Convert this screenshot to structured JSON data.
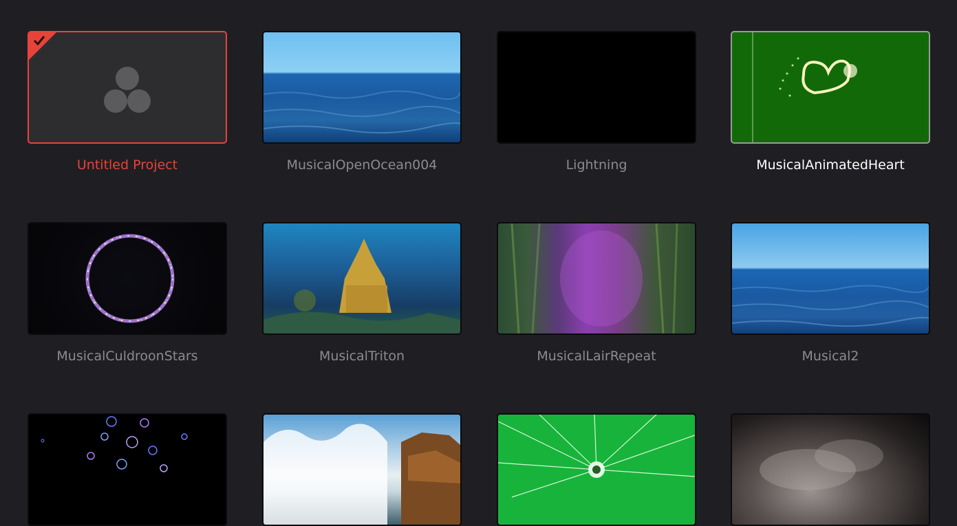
{
  "projects": [
    {
      "name": "Untitled Project",
      "state": "selected",
      "thumbnail": "resolve-logo-icon"
    },
    {
      "name": "MusicalOpenOcean004",
      "state": "normal",
      "thumbnail": "ocean"
    },
    {
      "name": "Lightning",
      "state": "normal",
      "thumbnail": "black"
    },
    {
      "name": "MusicalAnimatedHeart",
      "state": "hovered",
      "thumbnail": "green-heart"
    },
    {
      "name": "MusicalCuldroonStars",
      "state": "normal",
      "thumbnail": "star-ring"
    },
    {
      "name": "MusicalTriton",
      "state": "normal",
      "thumbnail": "underwater-castle"
    },
    {
      "name": "MusicalLairRepeat",
      "state": "normal",
      "thumbnail": "purple-lair"
    },
    {
      "name": "Musical2",
      "state": "normal",
      "thumbnail": "ocean"
    },
    {
      "name": "",
      "state": "normal",
      "thumbnail": "bubbles"
    },
    {
      "name": "",
      "state": "normal",
      "thumbnail": "crashing-waves"
    },
    {
      "name": "",
      "state": "normal",
      "thumbnail": "green-cracked-glass"
    },
    {
      "name": "",
      "state": "normal",
      "thumbnail": "smoke"
    }
  ],
  "colors": {
    "background": "#1f1f23",
    "selected_accent": "#e6443a",
    "label_default": "#8c8c8e",
    "label_hover": "#ffffff"
  }
}
